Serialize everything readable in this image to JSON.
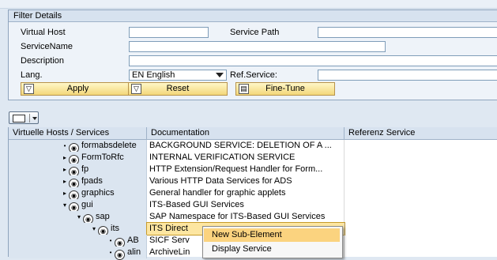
{
  "filter": {
    "title": "Filter Details",
    "fields": {
      "virtual_host_label": "Virtual Host",
      "virtual_host_value": "",
      "service_path_label": "Service Path",
      "service_path_value": "",
      "service_name_label": "ServiceName",
      "service_name_value": "",
      "description_label": "Description",
      "description_value": "",
      "lang_label": "Lang.",
      "lang_value": "EN English",
      "ref_service_label": "Ref.Service:",
      "ref_service_value": ""
    },
    "buttons": {
      "apply": "Apply",
      "reset": "Reset",
      "fine_tune": "Fine-Tune"
    }
  },
  "grid": {
    "columns": [
      "Virtuelle Hosts / Services",
      "Documentation",
      "Referenz Service"
    ],
    "rows": [
      {
        "name": "formabsdelete",
        "doc": "BACKGROUND SERVICE: DELETION OF A ...",
        "expander": "•"
      },
      {
        "name": "FormToRfc",
        "doc": "INTERNAL VERIFICATION SERVICE",
        "expander": "▸"
      },
      {
        "name": "fp",
        "doc": "HTTP Extension/Request Handler for Form...",
        "expander": "▸"
      },
      {
        "name": "fpads",
        "doc": "Various HTTP Data Services for ADS",
        "expander": "▸"
      },
      {
        "name": "graphics",
        "doc": "General handler for graphic applets",
        "expander": "▸"
      },
      {
        "name": "gui",
        "doc": "ITS-Based GUI Services",
        "expander": "▾"
      },
      {
        "name": "sap",
        "doc": "SAP Namespace for ITS-Based GUI Services",
        "expander": "▾"
      },
      {
        "name": "its",
        "doc": "ITS Direct",
        "expander": "▾"
      },
      {
        "name": "AB",
        "doc": "SICF Serv",
        "expander": "•"
      },
      {
        "name": "alin",
        "doc": "ArchiveLin",
        "expander": "•"
      }
    ]
  },
  "context_menu": {
    "items": [
      "New Sub-Element",
      "Display Service"
    ]
  },
  "colors": {
    "selection": "#fde6a1",
    "menu_highlight": "#fbd37f",
    "button": "#f3d77a"
  }
}
